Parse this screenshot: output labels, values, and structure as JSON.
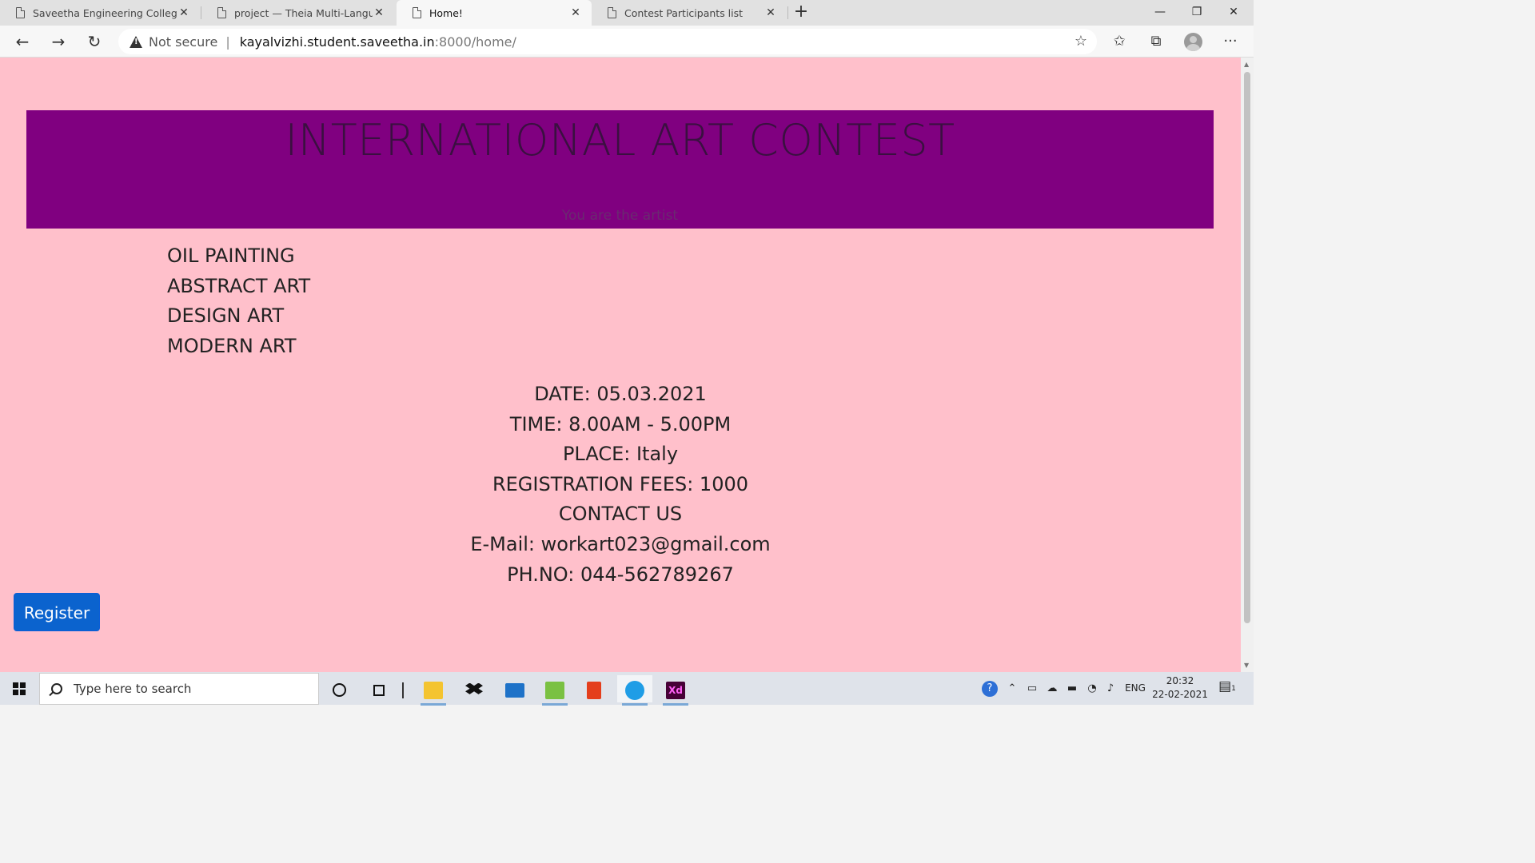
{
  "browser": {
    "tabs": [
      {
        "title": "Saveetha Engineering College",
        "active": false
      },
      {
        "title": "project — Theia Multi-Language",
        "active": false
      },
      {
        "title": "Home!",
        "active": true
      },
      {
        "title": "Contest Participants list",
        "active": false
      }
    ],
    "close_glyph": "✕",
    "new_tab_glyph": "+",
    "window_controls": {
      "minimize": "—",
      "restore": "❐",
      "close": "✕"
    },
    "nav": {
      "back": "←",
      "forward": "→",
      "reload": "↻"
    },
    "security_label": "Not secure",
    "url_sep": "|",
    "url_host": "kayalvizhi.student.saveetha.in",
    "url_rest": ":8000/home/",
    "toolbar_glyphs": {
      "favorite": "☆",
      "favorites": "✩",
      "collections": "⧉",
      "menu": "···"
    }
  },
  "page": {
    "background": "#ffc0cb",
    "banner_color": "#800080",
    "banner_title": "INTERNATIONAL ART CONTEST",
    "banner_subtitle": "You are the artist",
    "art_categories": [
      "OIL PAINTING",
      "ABSTRACT ART",
      "DESIGN ART",
      "MODERN ART"
    ],
    "info_lines": [
      "DATE: 05.03.2021",
      "TIME: 8.00AM - 5.00PM",
      "PLACE: Italy",
      "REGISTRATION FEES: 1000",
      "CONTACT US",
      "E-Mail: workart023@gmail.com",
      "PH.NO: 044-562789267"
    ],
    "register_label": "Register",
    "register_color": "#0b63ce"
  },
  "taskbar": {
    "search_placeholder": "Type here to search",
    "apps": [
      "cortana-icon",
      "task-view-icon",
      "file-explorer-icon",
      "dropbox-icon",
      "mail-icon",
      "sublime-icon",
      "office-icon",
      "edge-icon",
      "adobe-xd-icon"
    ],
    "xd_label": "Xd",
    "lang": "ENG",
    "time": "20:32",
    "date": "22-02-2021",
    "notification_count": "1"
  }
}
